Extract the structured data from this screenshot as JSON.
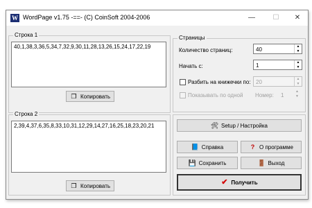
{
  "window": {
    "title": "WordPage v1.75 -==- (C) CoinSoft 2004-2006",
    "icon_letter": "W"
  },
  "controls": {
    "minimize": "—",
    "maximize": "☐",
    "close": "✕"
  },
  "row1": {
    "label": "Строка 1",
    "text": "40,1,38,3,36,5,34,7,32,9,30,11,28,13,26,15,24,17,22,19",
    "copy_label": "Копировать"
  },
  "row2": {
    "label": "Строка 2",
    "text": "2,39,4,37,6,35,8,33,10,31,12,29,14,27,16,25,18,23,20,21",
    "copy_label": "Копировать"
  },
  "pages": {
    "label": "Страницы",
    "count_label": "Количество страниц:",
    "count_value": "40",
    "start_label": "Начать с:",
    "start_value": "1",
    "split_label": "Разбить на книжечки по:",
    "split_value": "20",
    "split_checked": false,
    "show_one_label": "Показывать по одной",
    "show_one_checked": false,
    "number_label": "Номер:",
    "number_value": "1"
  },
  "buttons": {
    "setup": "Setup / Настройка",
    "help": "Справка",
    "about": "О программе",
    "save": "Сохранить",
    "exit": "Выход",
    "get": "Получить"
  },
  "icons": {
    "copy": "copy-icon",
    "setup": "setup-tools-icon",
    "help": "help-book-icon",
    "about": "question-mark-icon",
    "save": "floppy-disk-icon",
    "exit": "exit-door-icon",
    "get": "checkmark-icon"
  },
  "colors": {
    "title_icon": "#1c2f73",
    "check_red": "#d40000",
    "question_red": "#c00000"
  }
}
